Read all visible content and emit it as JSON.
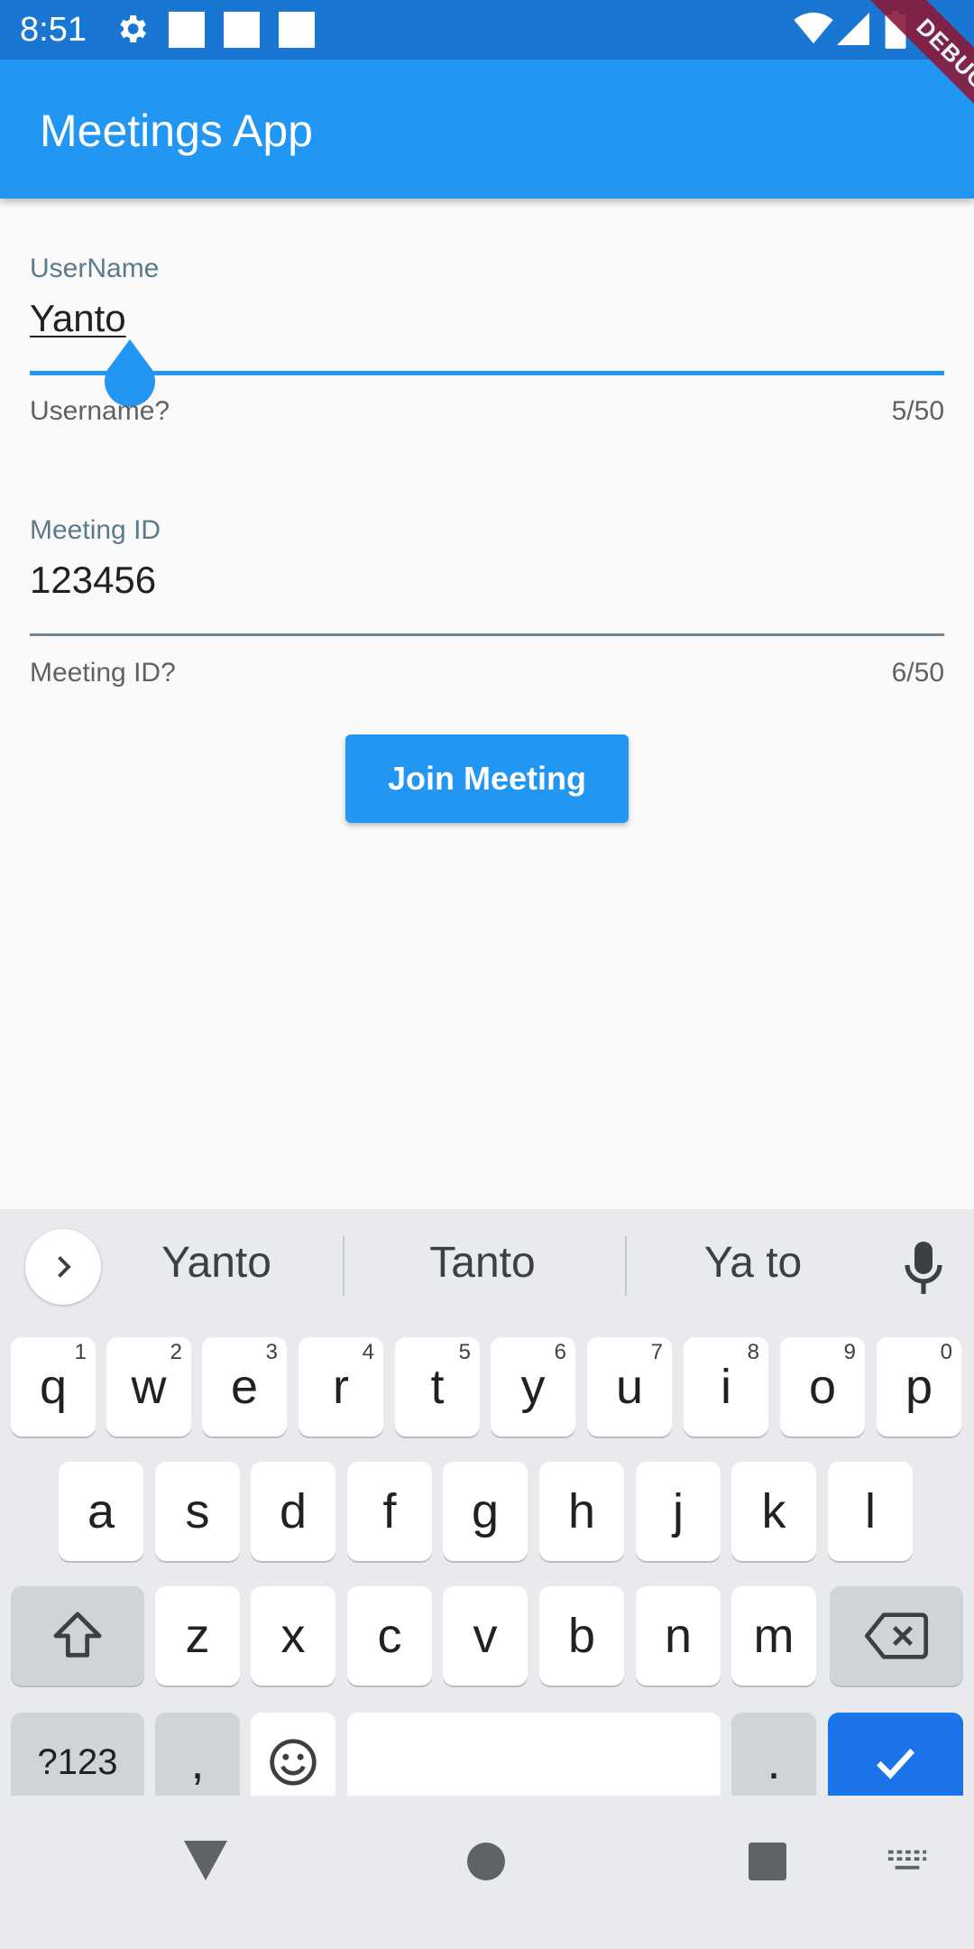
{
  "status_bar": {
    "time": "8:51",
    "icons": [
      "gear-icon",
      "notification-square",
      "notification-square",
      "notification-square",
      "wifi-icon",
      "signal-icon",
      "battery-icon"
    ]
  },
  "app_bar": {
    "title": "Meetings App"
  },
  "debug_banner": "DEBUG",
  "form": {
    "username": {
      "label": "UserName",
      "value": "Yanto",
      "helper": "Username?",
      "counter": "5/50"
    },
    "meeting_id": {
      "label": "Meeting ID",
      "value": "123456",
      "helper": "Meeting ID?",
      "counter": "6/50"
    },
    "join_label": "Join Meeting"
  },
  "keyboard": {
    "suggestions": [
      "Yanto",
      "Tanto",
      "Ya to"
    ],
    "row1": [
      {
        "key": "q",
        "hint": "1"
      },
      {
        "key": "w",
        "hint": "2"
      },
      {
        "key": "e",
        "hint": "3"
      },
      {
        "key": "r",
        "hint": "4"
      },
      {
        "key": "t",
        "hint": "5"
      },
      {
        "key": "y",
        "hint": "6"
      },
      {
        "key": "u",
        "hint": "7"
      },
      {
        "key": "i",
        "hint": "8"
      },
      {
        "key": "o",
        "hint": "9"
      },
      {
        "key": "p",
        "hint": "0"
      }
    ],
    "row2": [
      "a",
      "s",
      "d",
      "f",
      "g",
      "h",
      "j",
      "k",
      "l"
    ],
    "row3": [
      "z",
      "x",
      "c",
      "v",
      "b",
      "n",
      "m"
    ],
    "symbols_label": "?123",
    "comma_label": ",",
    "period_label": "."
  },
  "colors": {
    "status_bar": "#1976d2",
    "app_bar": "#2196f3",
    "accent": "#2196f3",
    "keyboard_bg": "#e8eaed",
    "enter_key": "#1a73e8"
  }
}
